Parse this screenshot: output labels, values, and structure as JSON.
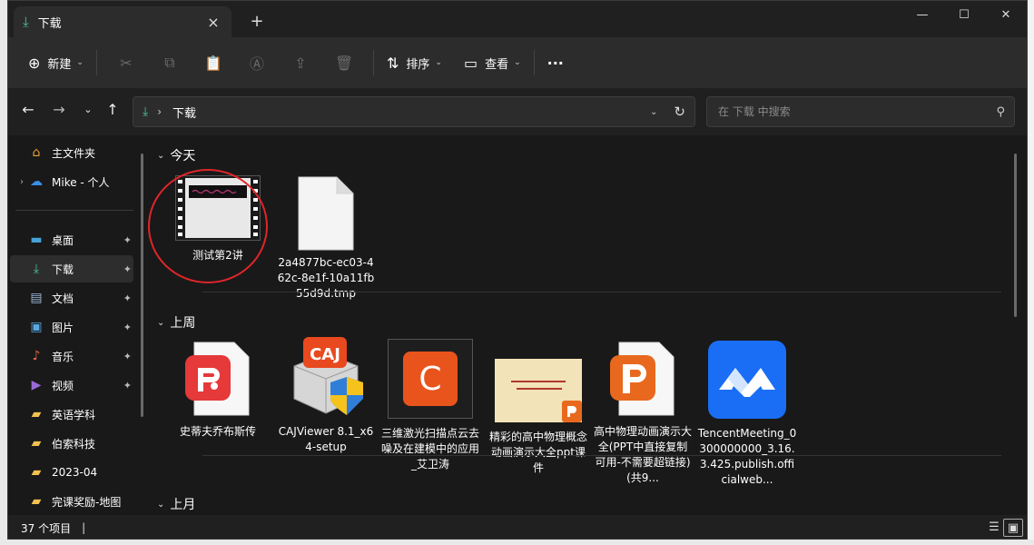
{
  "window": {
    "tab_title": "下载",
    "new_tab": "+",
    "controls": {
      "minimize": "—",
      "maximize": "☐",
      "close": "✕"
    }
  },
  "toolbar": {
    "new_label": "新建",
    "sort_label": "排序",
    "view_label": "查看",
    "more": "···"
  },
  "address": {
    "path": "下载",
    "search_placeholder": "在 下载 中搜索"
  },
  "sidebar": {
    "items": [
      {
        "label": "主文件夹",
        "icon": "home-icon",
        "pinned": false
      },
      {
        "label": "Mike - 个人",
        "icon": "cloud-icon",
        "pinned": false,
        "expandable": true
      },
      {
        "label": "桌面",
        "icon": "desktop-icon",
        "pinned": true
      },
      {
        "label": "下载",
        "icon": "download-icon",
        "pinned": true,
        "active": true
      },
      {
        "label": "文档",
        "icon": "document-icon",
        "pinned": true
      },
      {
        "label": "图片",
        "icon": "picture-icon",
        "pinned": true
      },
      {
        "label": "音乐",
        "icon": "music-icon",
        "pinned": true
      },
      {
        "label": "视频",
        "icon": "video-icon",
        "pinned": true
      },
      {
        "label": "英语学科",
        "icon": "folder-icon",
        "pinned": false
      },
      {
        "label": "伯索科技",
        "icon": "folder-icon",
        "pinned": false
      },
      {
        "label": "2023-04",
        "icon": "folder-icon",
        "pinned": false
      },
      {
        "label": "完课奖励-地图",
        "icon": "folder-icon",
        "pinned": false
      }
    ]
  },
  "groups": {
    "today": "今天",
    "last_week": "上周",
    "last_month": "上月"
  },
  "files_today": [
    {
      "name": "测试第2讲",
      "type": "video"
    },
    {
      "name": "2a4877bc-ec03-462c-8e1f-10a11fb55d9d.tmp",
      "type": "blank"
    }
  ],
  "files_last_week": [
    {
      "name": "史蒂夫乔布斯传",
      "type": "wps-pdf"
    },
    {
      "name": "CAJViewer 8.1_x64-setup",
      "type": "caj-installer",
      "badge": "CAJ"
    },
    {
      "name": "三维激光扫描点云去噪及在建模中的应用_艾卫涛",
      "type": "caj-doc",
      "badge": "C"
    },
    {
      "name": "精彩的高中物理概念动画演示大全ppt课件",
      "type": "ppt-thumb"
    },
    {
      "name": "高中物理动画演示大全(PPT中直接复制可用-不需要超链接)(共9...",
      "type": "wps-ppt"
    },
    {
      "name": "TencentMeeting_0300000000_3.16.3.425.publish.officialweb...",
      "type": "tencent-meeting"
    }
  ],
  "status": {
    "item_count": "37 个项目",
    "cursor": "|"
  },
  "colors": {
    "accent": "#4cc2a0",
    "highlight_circle": "#e0252a",
    "wps_red": "#e5393a",
    "wps_orange": "#e8691e",
    "tencent_blue": "#1a6ef5"
  }
}
